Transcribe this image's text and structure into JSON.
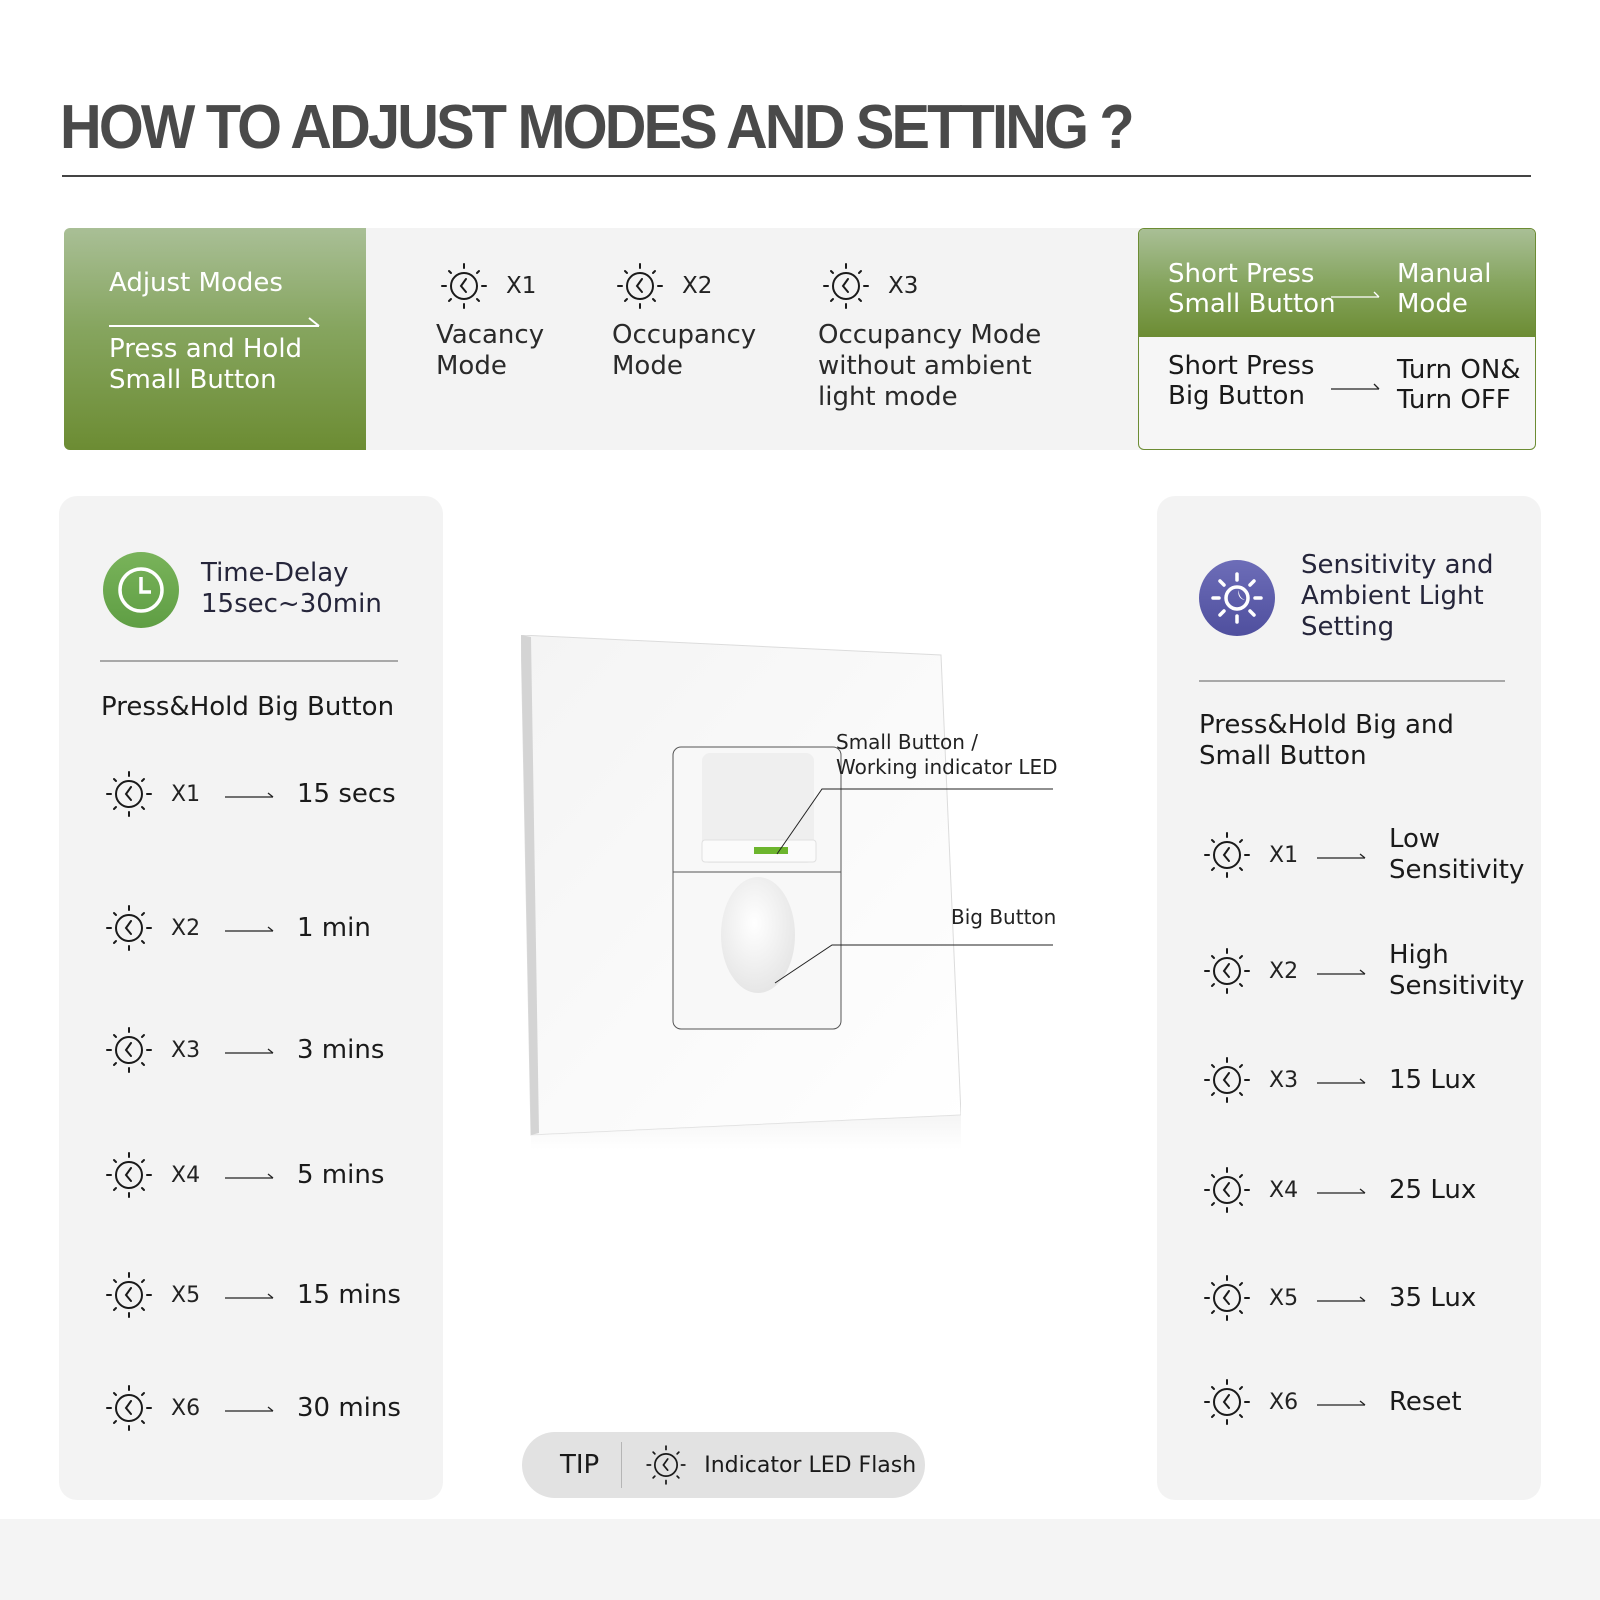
{
  "title": "HOW TO ADJUST MODES AND SETTING ?",
  "adjust_modes": {
    "heading": "Adjust Modes",
    "action_line1": "Press and Hold",
    "action_line2": "Small Button"
  },
  "modes": [
    {
      "count": "X1",
      "line1": "Vacancy",
      "line2": "Mode",
      "line3": ""
    },
    {
      "count": "X2",
      "line1": "Occupancy",
      "line2": "Mode",
      "line3": ""
    },
    {
      "count": "X3",
      "line1": "Occupancy Mode",
      "line2": "without ambient",
      "line3": "light mode"
    }
  ],
  "short_press": [
    {
      "action_line1": "Short Press",
      "action_line2": "Small Button",
      "result_line1": "Manual",
      "result_line2": "Mode"
    },
    {
      "action_line1": "Short Press",
      "action_line2": "Big Button",
      "result_line1": "Turn ON&",
      "result_line2": "Turn OFF"
    }
  ],
  "time_delay": {
    "title_line1": "Time-Delay",
    "title_line2": "15sec~30min",
    "instruction": "Press&Hold Big Button",
    "rows": [
      {
        "count": "X1",
        "value": "15 secs"
      },
      {
        "count": "X2",
        "value": "1 min"
      },
      {
        "count": "X3",
        "value": "3 mins"
      },
      {
        "count": "X4",
        "value": "5 mins"
      },
      {
        "count": "X5",
        "value": "15 mins"
      },
      {
        "count": "X6",
        "value": "30 mins"
      }
    ]
  },
  "sensitivity": {
    "title_line1": "Sensitivity and",
    "title_line2": "Ambient Light",
    "title_line3": "Setting",
    "instruction_line1": "Press&Hold Big and",
    "instruction_line2": "Small Button",
    "rows": [
      {
        "count": "X1",
        "value_line1": "Low",
        "value_line2": "Sensitivity"
      },
      {
        "count": "X2",
        "value_line1": "High",
        "value_line2": "Sensitivity"
      },
      {
        "count": "X3",
        "value_line1": "15 Lux",
        "value_line2": ""
      },
      {
        "count": "X4",
        "value_line1": "25 Lux",
        "value_line2": ""
      },
      {
        "count": "X5",
        "value_line1": "35 Lux",
        "value_line2": ""
      },
      {
        "count": "X6",
        "value_line1": "Reset",
        "value_line2": ""
      }
    ]
  },
  "device": {
    "small_button_label_line1": "Small Button /",
    "small_button_label_line2": "Working indicator LED",
    "big_button_label": "Big Button"
  },
  "tip": {
    "label": "TIP",
    "text": "Indicator LED Flash"
  },
  "colors": {
    "green_accent": "#6c8c33",
    "green_icon": "#6aa84f",
    "blue_icon": "#5a5aa8",
    "led_green": "#6cb52d"
  }
}
